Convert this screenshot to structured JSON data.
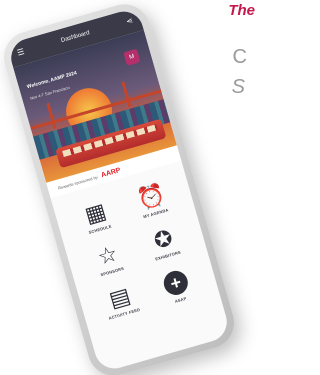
{
  "corner": {
    "headline": "The",
    "line1": "C",
    "line2": "S"
  },
  "app": {
    "title": "Dashboard",
    "welcome": "Welcome, AAMP 2024",
    "date": "Nov 4-7 San Francisco",
    "badge": "M",
    "sponsor_prefix": "Rewards sponsored by",
    "sponsor_name": "AARP"
  },
  "tiles": [
    {
      "label": "SCHEDULE",
      "icon": "calendar-icon"
    },
    {
      "label": "MY AGENDA",
      "icon": "alarm-clock-icon"
    },
    {
      "label": "SPONSORS",
      "icon": "star-icon"
    },
    {
      "label": "EXHIBITORS",
      "icon": "ribbon-badge-icon"
    },
    {
      "label": "ACTIVITY FEED",
      "icon": "newspaper-icon"
    },
    {
      "label": "ASAP",
      "icon": "plus-circle-icon"
    }
  ]
}
